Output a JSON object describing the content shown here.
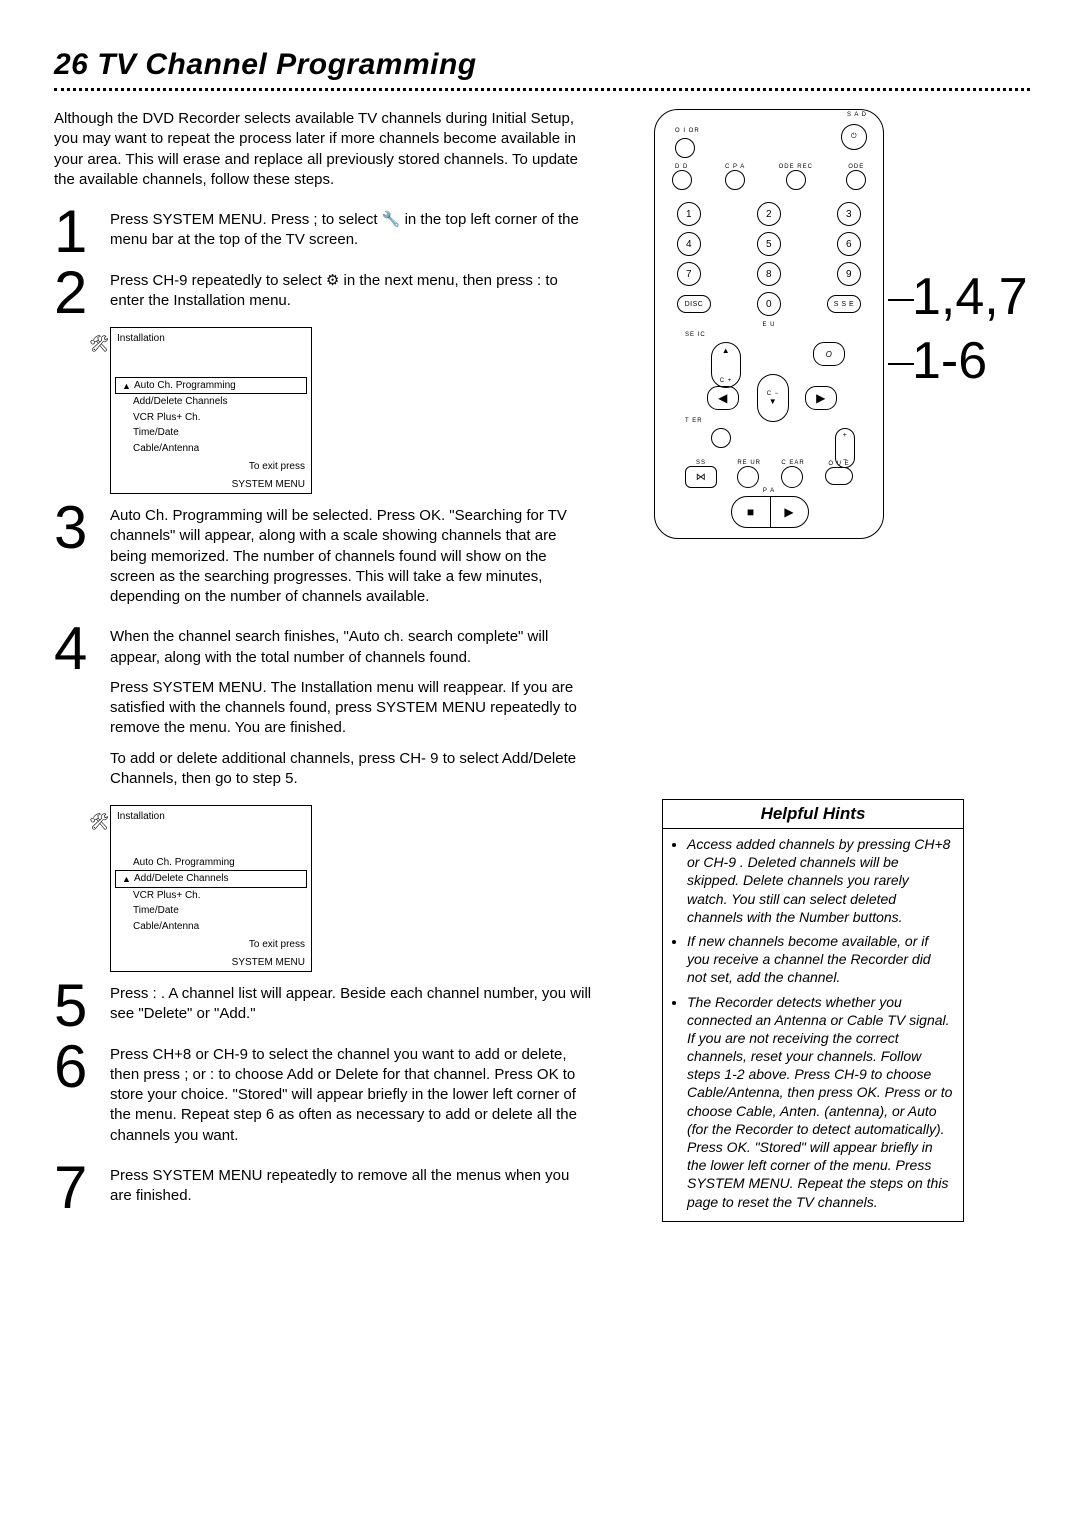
{
  "page_number": "26",
  "title": "TV Channel Programming",
  "intro": "Although the DVD Recorder selects available TV channels during Initial Setup, you may want to repeat the process later if more channels become available in your area. This will erase and replace all previously stored channels. To update the available channels, follow these steps.",
  "steps": {
    "s1": "Press SYSTEM MENU. Press ; to select 🔧 in the top left corner of the menu bar at the top of the TV screen.",
    "s2": "Press CH-9 repeatedly to select ⚙ in the next menu, then press : to enter the Installation menu.",
    "s3": "Auto Ch. Programming will be selected. Press OK. \"Searching for TV channels\" will appear, along with a scale showing channels that are being memorized. The number of channels found will show on the screen as the searching progresses. This will take a few minutes, depending on the number of channels available.",
    "s4a": "When the channel search finishes, \"Auto ch. search complete\" will appear, along with the total number of channels found.",
    "s4b": "Press SYSTEM MENU. The Installation menu will reappear. If you are satisfied with the channels found, press SYSTEM MENU repeatedly to remove the menu.    You are finished.",
    "s4c": "To add or delete additional channels, press CH-  9 to select Add/Delete Channels, then go to step 5.",
    "s5": "Press : . A channel list will appear. Beside each channel number, you will see \"Delete\" or \"Add.\"",
    "s6": "Press CH+8 or CH-9 to select the channel you want to add or delete, then press  ;  or  :  to choose Add or Delete for that channel. Press OK to store your choice.    \"Stored\" will appear briefly in the lower left corner of the menu. Repeat step 6 as often as necessary to add or delete all the channels you want.",
    "s7": "Press SYSTEM MENU repeatedly  to remove all the menus when you are finished."
  },
  "menu": {
    "title": "Installation",
    "items": [
      "Auto Ch. Programming",
      "Add/Delete Channels",
      "VCR Plus+ Ch.",
      "Time/Date",
      "Cable/Antenna"
    ],
    "footer1": "To exit press",
    "footer2": "SYSTEM MENU"
  },
  "remote": {
    "lbl_onoff": "O I OR",
    "lbl_standby": "S A D",
    "lbl_dvd": "D D",
    "lbl_vcrplus": "C P A",
    "lbl_moderec": "ODE REC",
    "lbl_mode": "ODE",
    "disc": "DISC",
    "sse": "S S E",
    "lbl_selic": "SE IC",
    "lbl_eu": "E U",
    "ok": "O",
    "lbl_ch_up": "C +",
    "lbl_ch_dn": "C −",
    "lbl_timer": "T ER",
    "lbl_ss": "SS",
    "lbl_reur": "RE UR",
    "lbl_clear": "C EAR",
    "lbl_oue": "O U E",
    "lbl_pa": "P A"
  },
  "callouts": {
    "c1": "1,4,7",
    "c2": "1-6"
  },
  "hints": {
    "title": "Helpful Hints",
    "items": [
      "Access added channels by pressing CH+8  or CH-9 . Deleted channels will be skipped. Delete channels you rarely watch. You still can select deleted channels with the Number buttons.",
      "If new channels become available, or if you receive a channel the Recorder did not set, add the channel.",
      "The Recorder detects whether you connected an Antenna or Cable TV signal. If you are not receiving the correct channels, reset your channels. Follow steps 1-2 above. Press CH-9 to choose Cable/Antenna, then press OK. Press     or     to choose Cable, Anten. (antenna), or Auto (for the Recorder to detect automatically). Press OK. \"Stored\" will appear briefly in the lower left corner of the menu. Press SYSTEM MENU. Repeat the steps on this page to reset the TV channels."
    ]
  }
}
